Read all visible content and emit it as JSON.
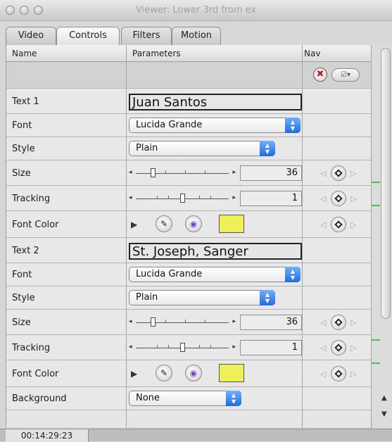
{
  "window": {
    "title": "Viewer: Lower 3rd from ex"
  },
  "tabs": [
    {
      "label": "Video"
    },
    {
      "label": "Controls",
      "active": true
    },
    {
      "label": "Filters"
    },
    {
      "label": "Motion"
    }
  ],
  "columns": {
    "name": "Name",
    "parameters": "Parameters",
    "nav": "Nav"
  },
  "params": {
    "text1": {
      "label": "Text 1",
      "value": "Juan Santos"
    },
    "font1": {
      "label": "Font",
      "value": "Lucida Grande"
    },
    "style1": {
      "label": "Style",
      "value": "Plain"
    },
    "size1": {
      "label": "Size",
      "value": "36"
    },
    "tracking1": {
      "label": "Tracking",
      "value": "1"
    },
    "color1": {
      "label": "Font Color",
      "swatch": "#eef05a"
    },
    "text2": {
      "label": "Text 2",
      "value": "St. Joseph, Sanger"
    },
    "font2": {
      "label": "Font",
      "value": "Lucida Grande"
    },
    "style2": {
      "label": "Style",
      "value": "Plain"
    },
    "size2": {
      "label": "Size",
      "value": "36"
    },
    "tracking2": {
      "label": "Tracking",
      "value": "1"
    },
    "color2": {
      "label": "Font Color",
      "swatch": "#eef05a"
    },
    "background": {
      "label": "Background",
      "value": "None"
    }
  },
  "timecode": "00:14:29:23",
  "icons": {
    "reset": "✖",
    "menu": "☑▾",
    "disclosure": "▶",
    "eyedropper": "✎",
    "colorwheel": "◉",
    "prev_kf": "◁",
    "next_kf": "▷"
  }
}
